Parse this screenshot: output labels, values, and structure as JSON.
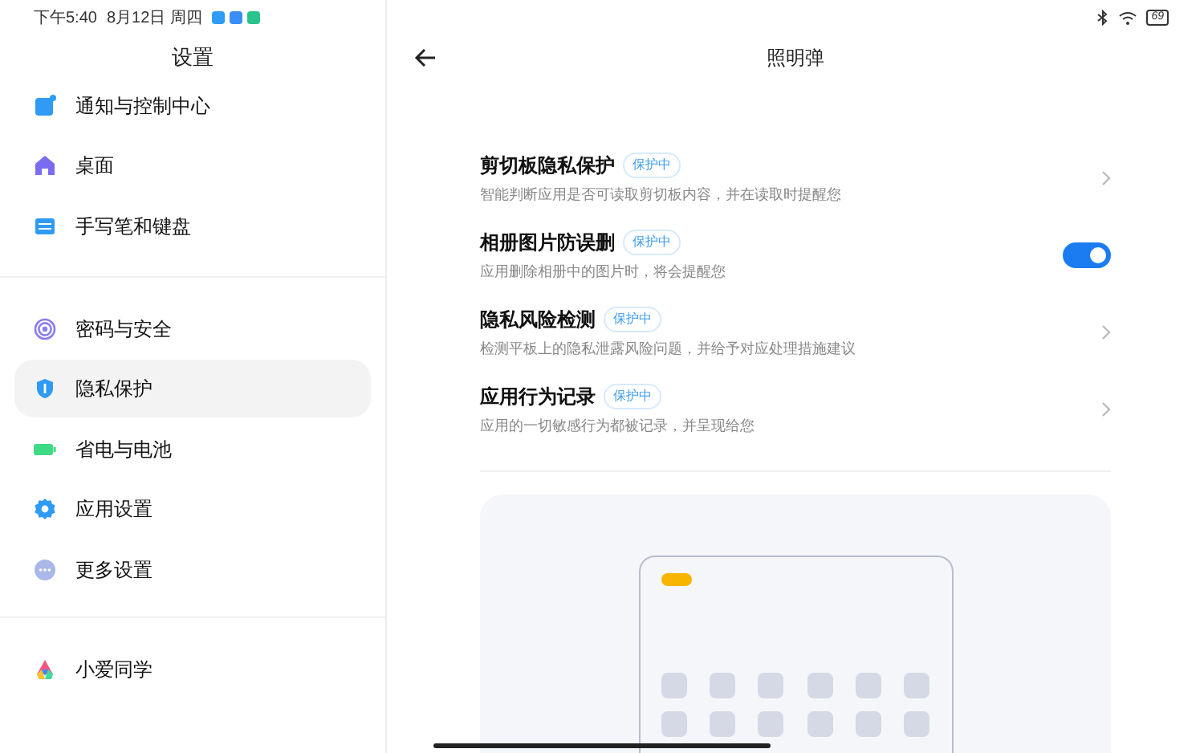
{
  "status_bar": {
    "time": "下午5:40",
    "date": "8月12日 周四",
    "battery": "69"
  },
  "sidebar": {
    "title": "设置",
    "groups": [
      {
        "items": [
          {
            "label": "通知与控制中心",
            "kind": "notification",
            "selected": false
          },
          {
            "label": "桌面",
            "kind": "home",
            "selected": false
          },
          {
            "label": "手写笔和键盘",
            "kind": "keyboard",
            "selected": false
          }
        ]
      },
      {
        "items": [
          {
            "label": "密码与安全",
            "kind": "fingerprint",
            "selected": false
          },
          {
            "label": "隐私保护",
            "kind": "privacy",
            "selected": true
          },
          {
            "label": "省电与电池",
            "kind": "battery",
            "selected": false
          },
          {
            "label": "应用设置",
            "kind": "gear",
            "selected": false
          },
          {
            "label": "更多设置",
            "kind": "more",
            "selected": false
          }
        ]
      },
      {
        "items": [
          {
            "label": "小爱同学",
            "kind": "assistant",
            "selected": false
          }
        ]
      }
    ]
  },
  "main": {
    "title": "照明弹",
    "items": [
      {
        "kind": "chevron",
        "title": "剪切板隐私保护",
        "badge": "保护中",
        "description": "智能判断应用是否可读取剪切板内容，并在读取时提醒您"
      },
      {
        "kind": "toggle",
        "title": "相册图片防误删",
        "badge": "保护中",
        "description": "应用删除相册中的图片时，将会提醒您",
        "on": true
      },
      {
        "kind": "chevron",
        "title": "隐私风险检测",
        "badge": "保护中",
        "description": "检测平板上的隐私泄露风险问题，并给予对应处理措施建议"
      },
      {
        "kind": "chevron",
        "title": "应用行为记录",
        "badge": "保护中",
        "description": "应用的一切敏感行为都被记录，并呈现给您"
      }
    ]
  }
}
